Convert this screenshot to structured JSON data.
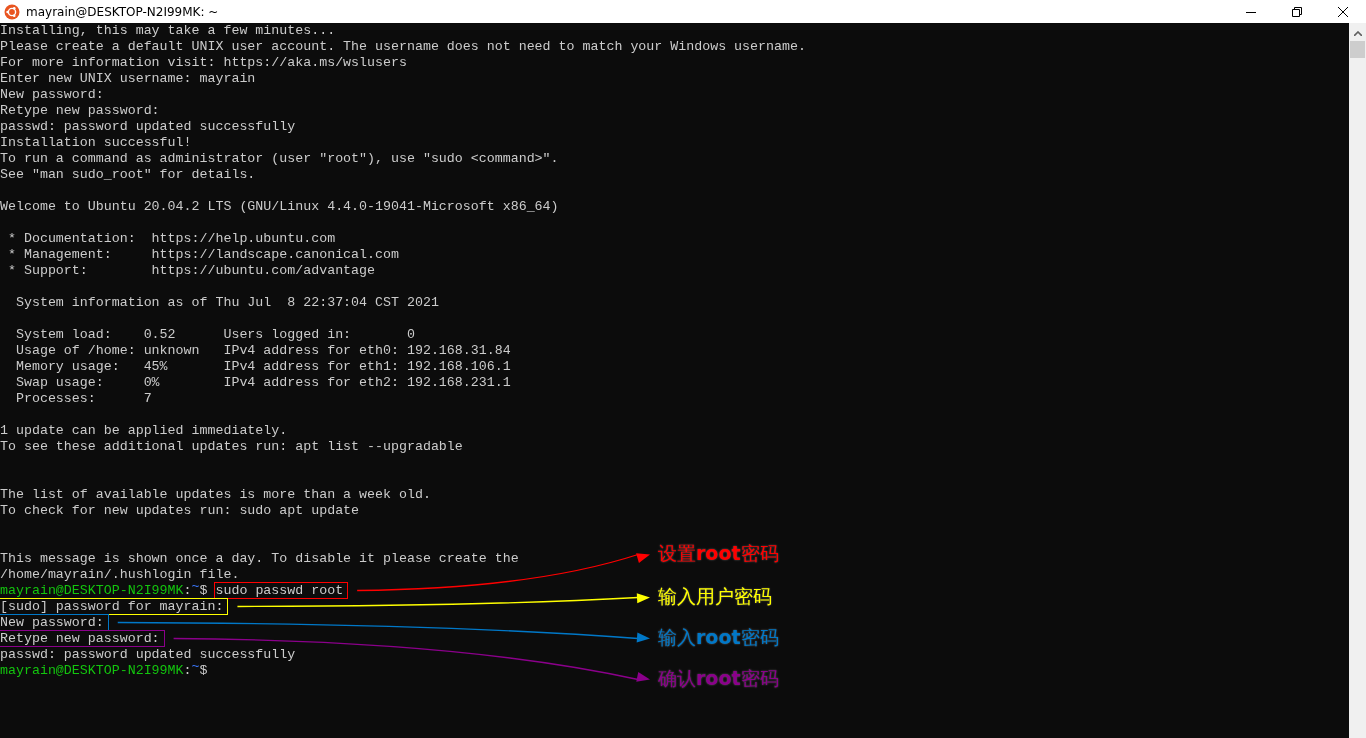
{
  "window": {
    "title": "mayrain@DESKTOP-N2I99MK: ~"
  },
  "terminal": {
    "lines": [
      {
        "kind": "output",
        "text": "Installing, this may take a few minutes..."
      },
      {
        "kind": "output",
        "text": "Please create a default UNIX user account. The username does not need to match your Windows username."
      },
      {
        "kind": "output",
        "text": "For more information visit: https://aka.ms/wslusers"
      },
      {
        "kind": "output",
        "text": "Enter new UNIX username: mayrain"
      },
      {
        "kind": "output",
        "text": "New password:"
      },
      {
        "kind": "output",
        "text": "Retype new password:"
      },
      {
        "kind": "output",
        "text": "passwd: password updated successfully"
      },
      {
        "kind": "output",
        "text": "Installation successful!"
      },
      {
        "kind": "output",
        "text": "To run a command as administrator (user \"root\"), use \"sudo <command>\"."
      },
      {
        "kind": "output",
        "text": "See \"man sudo_root\" for details."
      },
      {
        "kind": "blank"
      },
      {
        "kind": "output",
        "text": "Welcome to Ubuntu 20.04.2 LTS (GNU/Linux 4.4.0-19041-Microsoft x86_64)"
      },
      {
        "kind": "blank"
      },
      {
        "kind": "output",
        "text": " * Documentation:  https://help.ubuntu.com"
      },
      {
        "kind": "output",
        "text": " * Management:     https://landscape.canonical.com"
      },
      {
        "kind": "output",
        "text": " * Support:        https://ubuntu.com/advantage"
      },
      {
        "kind": "blank"
      },
      {
        "kind": "output",
        "text": "  System information as of Thu Jul  8 22:37:04 CST 2021"
      },
      {
        "kind": "blank"
      },
      {
        "kind": "output",
        "text": "  System load:    0.52      Users logged in:       0"
      },
      {
        "kind": "output",
        "text": "  Usage of /home: unknown   IPv4 address for eth0: 192.168.31.84"
      },
      {
        "kind": "output",
        "text": "  Memory usage:   45%       IPv4 address for eth1: 192.168.106.1"
      },
      {
        "kind": "output",
        "text": "  Swap usage:     0%        IPv4 address for eth2: 192.168.231.1"
      },
      {
        "kind": "output",
        "text": "  Processes:      7"
      },
      {
        "kind": "blank"
      },
      {
        "kind": "output",
        "text": "1 update can be applied immediately."
      },
      {
        "kind": "output",
        "text": "To see these additional updates run: apt list --upgradable"
      },
      {
        "kind": "blank"
      },
      {
        "kind": "blank"
      },
      {
        "kind": "output",
        "text": "The list of available updates is more than a week old."
      },
      {
        "kind": "output",
        "text": "To check for new updates run: sudo apt update"
      },
      {
        "kind": "blank"
      },
      {
        "kind": "blank"
      },
      {
        "kind": "output",
        "text": "This message is shown once a day. To disable it please create the"
      },
      {
        "kind": "output",
        "text": "/home/mayrain/.hushlogin file."
      },
      {
        "kind": "prompt",
        "user": "mayrain@DESKTOP-N2I99MK",
        "separator": ":",
        "path": "~",
        "symbol": "$",
        "command": "sudo passwd root",
        "note": {
          "label": "设置**root**密码",
          "color": "#ff0000"
        }
      },
      {
        "kind": "output",
        "text": "[sudo] password for mayrain:",
        "note": {
          "label": "输入用户密码",
          "color": "#ffff00"
        }
      },
      {
        "kind": "output",
        "text": "New password:",
        "note": {
          "label": "输入**root**密码",
          "color": "#0078c8"
        }
      },
      {
        "kind": "output",
        "text": "Retype new password:",
        "note": {
          "label": "确认**root**密码",
          "color": "#8b008b"
        }
      },
      {
        "kind": "output",
        "text": "passwd: password updated successfully"
      },
      {
        "kind": "prompt",
        "user": "mayrain@DESKTOP-N2I99MK",
        "separator": ":",
        "path": "~",
        "symbol": "$"
      }
    ]
  }
}
